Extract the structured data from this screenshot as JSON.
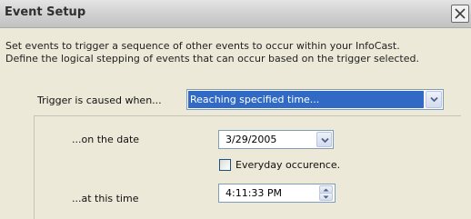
{
  "window": {
    "title": "Event Setup",
    "close_icon": "close-icon"
  },
  "intro": {
    "line1": "Set events to trigger a sequence of other events to occur within your InfoCast.",
    "line2": "Define the logical stepping of events that can occur based on the trigger selected."
  },
  "trigger": {
    "label": "Trigger is caused when...",
    "selected": "Reaching specified time..."
  },
  "date": {
    "label": "...on the date",
    "value": "3/29/2005"
  },
  "everyday": {
    "label": "Everyday occurence.",
    "checked": false
  },
  "time": {
    "label": "...at this time",
    "value": "4:11:33 PM"
  },
  "colors": {
    "selection": "#316ac5",
    "dialog_bg": "#ece9d8",
    "field_border": "#7f9db9"
  }
}
